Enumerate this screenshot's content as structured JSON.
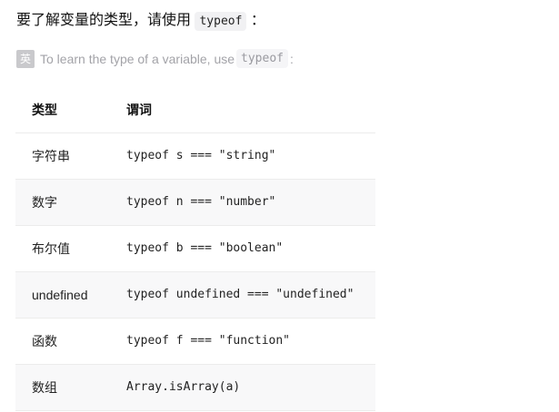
{
  "intro": {
    "text": "要了解变量的类型，请使用",
    "code": "typeof",
    "suffix": "："
  },
  "translation": {
    "badge": "英",
    "text": "To learn the type of a variable, use",
    "code": "typeof",
    "suffix": ":"
  },
  "table": {
    "headers": [
      "类型",
      "谓词"
    ],
    "rows": [
      {
        "type": "字符串",
        "predicate": "typeof s === \"string\""
      },
      {
        "type": "数字",
        "predicate": "typeof n === \"number\""
      },
      {
        "type": "布尔值",
        "predicate": "typeof b === \"boolean\""
      },
      {
        "type": "undefined",
        "predicate": "typeof undefined === \"undefined\""
      },
      {
        "type": "函数",
        "predicate": "typeof f === \"function\""
      },
      {
        "type": "数组",
        "predicate": "Array.isArray(a)"
      }
    ]
  }
}
